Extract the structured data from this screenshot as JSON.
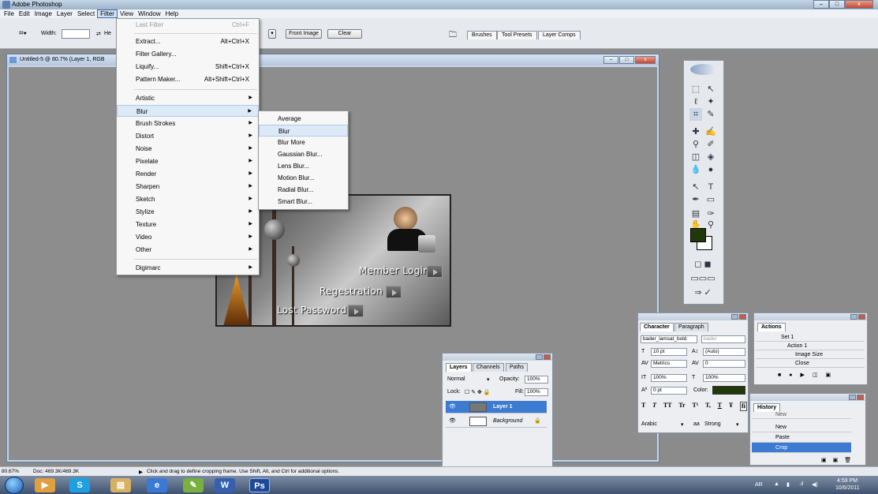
{
  "app": {
    "title": "Adobe Photoshop",
    "window_buttons": [
      "–",
      "□",
      "x"
    ]
  },
  "menubar": [
    "File",
    "Edit",
    "Image",
    "Layer",
    "Select",
    "Filter",
    "View",
    "Window",
    "Help"
  ],
  "options_bar": {
    "width_label": "Width:",
    "height_label": "He",
    "front_image_label": "Front Image",
    "clear_label": "Clear",
    "well_tabs": [
      "Brushes",
      "Tool Presets",
      "Layer Comps"
    ]
  },
  "document": {
    "title": "Untitled-5 @ 80.7% (Layer 1, RGB",
    "artwork": {
      "member_login": "Member Login",
      "registration": "Regestration",
      "lost_password": "Lost Password"
    }
  },
  "filter_menu": {
    "items": [
      {
        "label": "Last Filter",
        "shortcut": "Ctrl+F",
        "disabled": true
      },
      {
        "label": "Extract...",
        "shortcut": "Alt+Ctrl+X"
      },
      {
        "label": "Filter Gallery...",
        "shortcut": ""
      },
      {
        "label": "Liquify...",
        "shortcut": "Shift+Ctrl+X"
      },
      {
        "label": "Pattern Maker...",
        "shortcut": "Alt+Shift+Ctrl+X"
      },
      {
        "label": "Artistic",
        "submenu": true
      },
      {
        "label": "Blur",
        "submenu": true,
        "highlighted": true
      },
      {
        "label": "Brush Strokes",
        "submenu": true
      },
      {
        "label": "Distort",
        "submenu": true
      },
      {
        "label": "Noise",
        "submenu": true
      },
      {
        "label": "Pixelate",
        "submenu": true
      },
      {
        "label": "Render",
        "submenu": true
      },
      {
        "label": "Sharpen",
        "submenu": true
      },
      {
        "label": "Sketch",
        "submenu": true
      },
      {
        "label": "Stylize",
        "submenu": true
      },
      {
        "label": "Texture",
        "submenu": true
      },
      {
        "label": "Video",
        "submenu": true
      },
      {
        "label": "Other",
        "submenu": true
      },
      {
        "label": "Digimarc",
        "submenu": true
      }
    ]
  },
  "blur_submenu": {
    "items": [
      "Average",
      "Blur",
      "Blur More",
      "Gaussian Blur...",
      "Lens Blur...",
      "Motion Blur...",
      "Radial Blur...",
      "Smart Blur..."
    ],
    "highlighted": "Blur"
  },
  "character_panel": {
    "tabs": [
      "Character",
      "Paragraph"
    ],
    "font_family": "bader_lamsat_bold",
    "font_style": "bader",
    "size": "10 pt",
    "leading": "(Auto)",
    "kerning": "Metrics",
    "tracking": "0",
    "vscale": "100%",
    "hscale": "100%",
    "baseline": "0 pt",
    "color_label": "Color:",
    "color": "#1f3a08",
    "style_buttons": [
      "T",
      "T",
      "TT",
      "Tr",
      "T¹",
      "T,",
      "T",
      "Ŧ",
      "fi"
    ],
    "language": "Arabic",
    "antialias_icon": "aa",
    "antialias": "Strong"
  },
  "layers_panel": {
    "tabs": [
      "Layers",
      "Channels",
      "Paths"
    ],
    "blend_mode": "Normal",
    "opacity_label": "Opacity:",
    "opacity": "100%",
    "lock_label": "Lock:",
    "fill_label": "Fill:",
    "fill": "100%",
    "layers": [
      {
        "name": "Layer 1",
        "selected": true
      },
      {
        "name": "Background",
        "selected": false,
        "locked": true
      }
    ]
  },
  "actions_panel": {
    "tabs": [
      "Actions"
    ],
    "items": [
      "Set 1",
      "Action 1",
      "Image Size",
      "Close"
    ]
  },
  "history_panel": {
    "tabs": [
      "History"
    ],
    "items": [
      {
        "label": "New",
        "selected": false
      },
      {
        "label": "New",
        "selected": false
      },
      {
        "label": "Paste",
        "selected": false
      },
      {
        "label": "Crop",
        "selected": true
      }
    ]
  },
  "statusbar": {
    "zoom": "80.67%",
    "doc": "Doc: 469.3K/469.3K",
    "hint": "Click and drag to define cropping frame. Use Shift, Alt, and Ctrl for additional options."
  },
  "taskbar": {
    "language": "AR",
    "time": "4:59 PM",
    "date": "10/6/2011"
  }
}
